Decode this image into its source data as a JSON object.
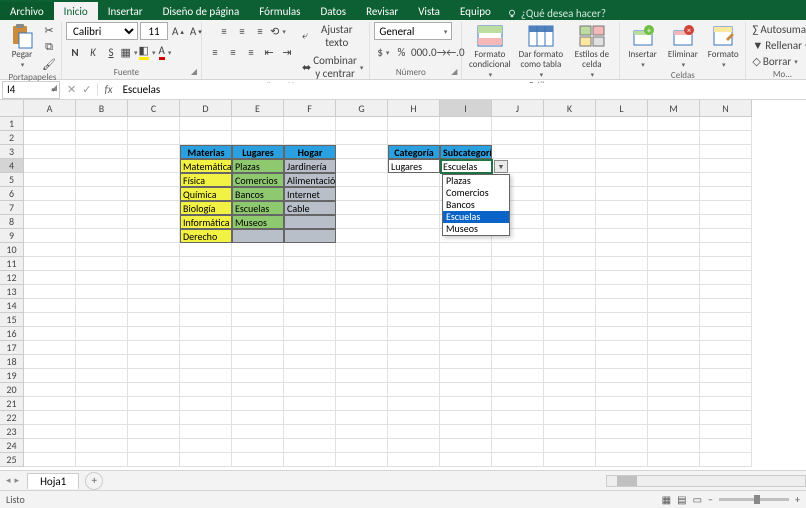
{
  "tabs": {
    "file": "Archivo",
    "home": "Inicio",
    "insert": "Insertar",
    "layout": "Diseño de página",
    "formulas": "Fórmulas",
    "data": "Datos",
    "review": "Revisar",
    "view": "Vista",
    "team": "Equipo",
    "tellme": "¿Qué desea hacer?"
  },
  "ribbon": {
    "clipboard": {
      "label": "Portapapeles",
      "paste": "Pegar"
    },
    "font": {
      "label": "Fuente",
      "name": "Calibri",
      "size": "11"
    },
    "align": {
      "label": "Alineación",
      "wrap": "Ajustar texto",
      "merge": "Combinar y centrar"
    },
    "number": {
      "label": "Número",
      "format": "General"
    },
    "styles": {
      "label": "Estilos",
      "cond": "Formato condicional",
      "table": "Dar formato como tabla",
      "cell": "Estilos de celda"
    },
    "cells": {
      "label": "Celdas",
      "insert": "Insertar",
      "delete": "Eliminar",
      "format": "Formato"
    },
    "editing": {
      "label": "Mo...",
      "autosum": "Autosuma",
      "fill": "Rellenar",
      "clear": "Borrar"
    }
  },
  "namebox": "I4",
  "formula": "Escuelas",
  "cols": [
    "A",
    "B",
    "C",
    "D",
    "E",
    "F",
    "G",
    "H",
    "I",
    "J",
    "K",
    "L",
    "M",
    "N"
  ],
  "rows": 25,
  "table1": {
    "headers": [
      "Materias",
      "Lugares",
      "Hogar"
    ],
    "rows": [
      [
        "Matemática",
        "Plazas",
        "Jardinería"
      ],
      [
        "Física",
        "Comercios",
        "Alimentación"
      ],
      [
        "Química",
        "Bancos",
        "Internet"
      ],
      [
        "Biología",
        "Escuelas",
        "Cable"
      ],
      [
        "Informática",
        "Museos",
        ""
      ],
      [
        "Derecho",
        "",
        ""
      ]
    ]
  },
  "table2": {
    "headers": [
      "Categoría",
      "Subcategoría"
    ],
    "row": [
      "Lugares",
      "Escuelas"
    ]
  },
  "dropdown": {
    "items": [
      "Plazas",
      "Comercios",
      "Bancos",
      "Escuelas",
      "Museos"
    ],
    "highlighted": 3
  },
  "sheet": {
    "name": "Hoja1"
  },
  "status": {
    "ready": "Listo"
  }
}
